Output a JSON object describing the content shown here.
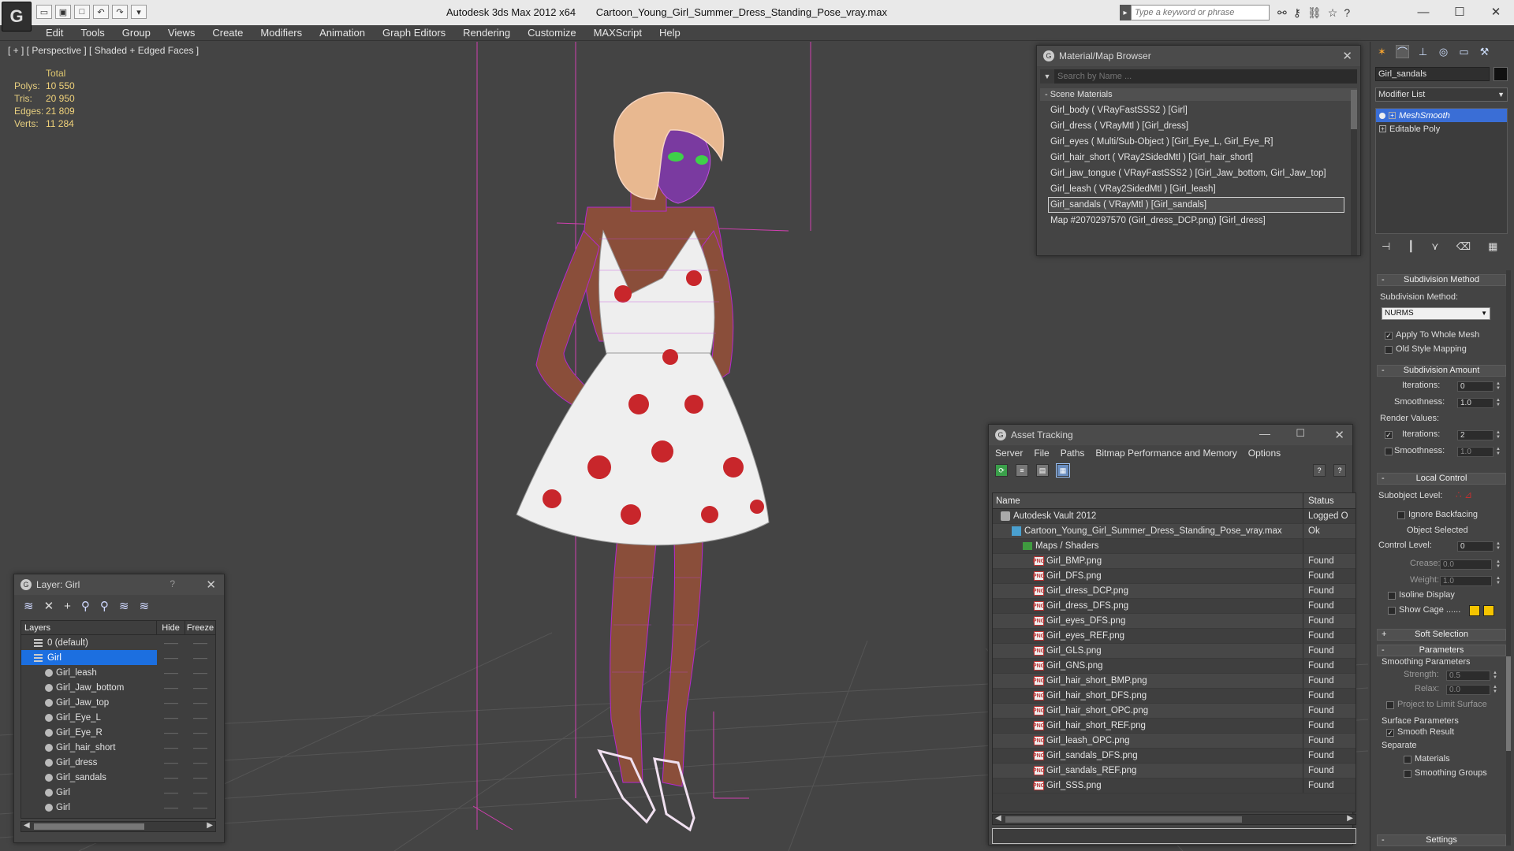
{
  "titlebar": {
    "app_name": "Autodesk 3ds Max  2012 x64",
    "file_name": "Cartoon_Young_Girl_Summer_Dress_Standing_Pose_vray.max",
    "search_placeholder": "Type a keyword or phrase",
    "logo_letter": "G",
    "quick_access": [
      "open",
      "save",
      "new",
      "undo",
      "redo",
      "more"
    ],
    "window_controls": {
      "minimize": "—",
      "maximize": "☐",
      "close": "✕"
    }
  },
  "menu": {
    "items": [
      "Edit",
      "Tools",
      "Group",
      "Views",
      "Create",
      "Modifiers",
      "Animation",
      "Graph Editors",
      "Rendering",
      "Customize",
      "MAXScript",
      "Help"
    ]
  },
  "viewport": {
    "label": "[ + ] [ Perspective ] [ Shaded + Edged Faces ]",
    "stats": {
      "header": "Total",
      "rows": [
        {
          "key": "Polys:",
          "value": "10 550"
        },
        {
          "key": "Tris:",
          "value": "20 950"
        },
        {
          "key": "Edges:",
          "value": "21 809"
        },
        {
          "key": "Verts:",
          "value": "11 284"
        }
      ]
    }
  },
  "material_browser": {
    "title": "Material/Map Browser",
    "search_placeholder": "Search by Name ...",
    "section": "- Scene Materials",
    "items": [
      "Girl_body  ( VRayFastSSS2 ) [Girl]",
      "Girl_dress  ( VRayMtl ) [Girl_dress]",
      "Girl_eyes  ( Multi/Sub-Object ) [Girl_Eye_L, Girl_Eye_R]",
      "Girl_hair_short  ( VRay2SidedMtl ) [Girl_hair_short]",
      "Girl_jaw_tongue  ( VRayFastSSS2 ) [Girl_Jaw_bottom, Girl_Jaw_top]",
      "Girl_leash  ( VRay2SidedMtl ) [Girl_leash]",
      "Girl_sandals  ( VRayMtl ) [Girl_sandals]",
      "Map #2070297570 (Girl_dress_DCP.png) [Girl_dress]"
    ],
    "selected_index": 6
  },
  "asset_tracking": {
    "title": "Asset Tracking",
    "menu": [
      "Server",
      "File",
      "Paths",
      "Bitmap Performance and Memory",
      "Options"
    ],
    "columns": {
      "name": "Name",
      "status": "Status"
    },
    "rows": [
      {
        "name": "Autodesk Vault 2012",
        "status": "Logged O",
        "type": "vault",
        "indent": 1
      },
      {
        "name": "Cartoon_Young_Girl_Summer_Dress_Standing_Pose_vray.max",
        "status": "Ok",
        "type": "max",
        "indent": 2
      },
      {
        "name": "Maps / Shaders",
        "status": "",
        "type": "folder",
        "indent": 3
      },
      {
        "name": "Girl_BMP.png",
        "status": "Found",
        "type": "png",
        "indent": 4
      },
      {
        "name": "Girl_DFS.png",
        "status": "Found",
        "type": "png",
        "indent": 4
      },
      {
        "name": "Girl_dress_DCP.png",
        "status": "Found",
        "type": "png",
        "indent": 4
      },
      {
        "name": "Girl_dress_DFS.png",
        "status": "Found",
        "type": "png",
        "indent": 4
      },
      {
        "name": "Girl_eyes_DFS.png",
        "status": "Found",
        "type": "png",
        "indent": 4
      },
      {
        "name": "Girl_eyes_REF.png",
        "status": "Found",
        "type": "png",
        "indent": 4
      },
      {
        "name": "Girl_GLS.png",
        "status": "Found",
        "type": "png",
        "indent": 4
      },
      {
        "name": "Girl_GNS.png",
        "status": "Found",
        "type": "png",
        "indent": 4
      },
      {
        "name": "Girl_hair_short_BMP.png",
        "status": "Found",
        "type": "png",
        "indent": 4
      },
      {
        "name": "Girl_hair_short_DFS.png",
        "status": "Found",
        "type": "png",
        "indent": 4
      },
      {
        "name": "Girl_hair_short_OPC.png",
        "status": "Found",
        "type": "png",
        "indent": 4
      },
      {
        "name": "Girl_hair_short_REF.png",
        "status": "Found",
        "type": "png",
        "indent": 4
      },
      {
        "name": "Girl_leash_OPC.png",
        "status": "Found",
        "type": "png",
        "indent": 4
      },
      {
        "name": "Girl_sandals_DFS.png",
        "status": "Found",
        "type": "png",
        "indent": 4
      },
      {
        "name": "Girl_sandals_REF.png",
        "status": "Found",
        "type": "png",
        "indent": 4
      },
      {
        "name": "Girl_SSS.png",
        "status": "Found",
        "type": "png",
        "indent": 4
      }
    ]
  },
  "layer_panel": {
    "title": "Layer: Girl",
    "help": "?",
    "columns": {
      "layers": "Layers",
      "hide": "Hide",
      "freeze": "Freeze"
    },
    "rows": [
      {
        "name": "0 (default)",
        "kind": "layer",
        "selected": false
      },
      {
        "name": "Girl",
        "kind": "layer",
        "selected": true
      },
      {
        "name": "Girl_leash",
        "kind": "object",
        "selected": false
      },
      {
        "name": "Girl_Jaw_bottom",
        "kind": "object",
        "selected": false
      },
      {
        "name": "Girl_Jaw_top",
        "kind": "object",
        "selected": false
      },
      {
        "name": "Girl_Eye_L",
        "kind": "object",
        "selected": false
      },
      {
        "name": "Girl_Eye_R",
        "kind": "object",
        "selected": false
      },
      {
        "name": "Girl_hair_short",
        "kind": "object",
        "selected": false
      },
      {
        "name": "Girl_dress",
        "kind": "object",
        "selected": false
      },
      {
        "name": "Girl_sandals",
        "kind": "object",
        "selected": false
      },
      {
        "name": "Girl",
        "kind": "object",
        "selected": false
      },
      {
        "name": "Girl",
        "kind": "object",
        "selected": false
      }
    ]
  },
  "command_panel": {
    "object_name": "Girl_sandals",
    "modifier_list": "Modifier List",
    "stack": [
      {
        "label": "MeshSmooth",
        "selected": true
      },
      {
        "label": "Editable Poly",
        "selected": false
      }
    ],
    "subdivision_method": {
      "title": "Subdivision Method",
      "label": "Subdivision Method:",
      "value": "NURMS",
      "apply_whole_mesh": "Apply To Whole Mesh",
      "old_style_mapping": "Old Style Mapping"
    },
    "subdivision_amount": {
      "title": "Subdivision Amount",
      "iterations_label": "Iterations:",
      "iterations": "0",
      "smoothness_label": "Smoothness:",
      "smoothness": "1.0",
      "render_values": "Render Values:",
      "render_iterations": "2",
      "render_smoothness": "1.0"
    },
    "local_control": {
      "title": "Local Control",
      "subobject_level": "Subobject Level:",
      "ignore_backfacing": "Ignore Backfacing",
      "object_selected": "Object Selected",
      "control_level_label": "Control Level:",
      "control_level": "0",
      "crease_label": "Crease:",
      "crease": "0.0",
      "weight_label": "Weight:",
      "weight": "1.0",
      "isoline_display": "Isoline Display",
      "show_cage": "Show Cage ......"
    },
    "soft_selection": {
      "title": "Soft Selection"
    },
    "parameters": {
      "title": "Parameters",
      "smoothing_parameters": "Smoothing Parameters",
      "strength_label": "Strength:",
      "strength": "0.5",
      "relax_label": "Relax:",
      "relax": "0.0",
      "project_limit": "Project to Limit Surface",
      "surface_parameters": "Surface Parameters",
      "smooth_result": "Smooth Result",
      "separate": "Separate",
      "materials": "Materials",
      "smoothing_groups": "Smoothing Groups"
    },
    "settings": {
      "title": "Settings"
    }
  },
  "colors": {
    "accent_blue": "#1c6fe0",
    "viewport_bg": "#444444",
    "stats_text": "#f0d27a",
    "wire_magenta": "#b428d0",
    "cage_yellow": "#f5c400"
  }
}
